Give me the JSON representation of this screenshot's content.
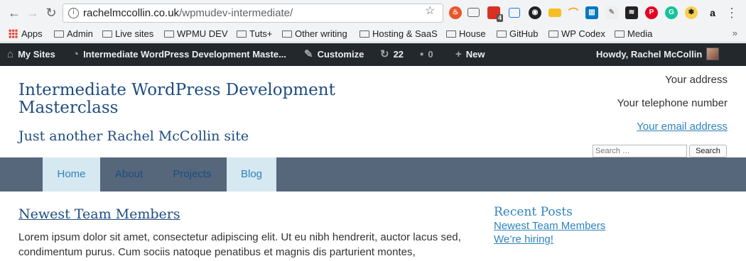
{
  "browser": {
    "url_host": "rachelmccollin.co.uk",
    "url_path": "/wpmudev-intermediate/",
    "extension_badge": "4",
    "bookmarks": [
      "Apps",
      "Admin",
      "Live sites",
      "WPMU DEV",
      "Tuts+",
      "Other writing",
      "Hosting & SaaS",
      "House",
      "GitHub",
      "WP Codex",
      "Media"
    ]
  },
  "adminbar": {
    "my_sites": "My Sites",
    "site_name": "Intermediate WordPress Development Maste...",
    "customize": "Customize",
    "updates_count": "22",
    "comments_count": "0",
    "new": "New",
    "howdy": "Howdy, Rachel McCollin"
  },
  "site": {
    "title": "Intermediate WordPress Development Masterclass",
    "tagline": "Just another Rachel McCollin site",
    "address": "Your address",
    "telephone": "Your telephone number",
    "email": "Your email address",
    "search_placeholder": "Search …",
    "search_button": "Search"
  },
  "menu": {
    "items": [
      "Home",
      "About",
      "Projects",
      "Blog"
    ]
  },
  "post": {
    "title": "Newest Team Members",
    "excerpt": "Lorem ipsum dolor sit amet, consectetur adipiscing elit. Ut eu nibh hendrerit, auctor lacus sed, condimentum purus. Cum sociis natoque penatibus et magnis dis parturient montes,"
  },
  "sidebar": {
    "recent_posts_title": "Recent Posts",
    "recent_posts": [
      "Newest Team Members",
      "We’re hiring!"
    ]
  },
  "colors": {
    "admin_bar": "#23282d",
    "menu_bar": "#56677c",
    "menu_highlight": "#d6e8f0",
    "title_blue": "#1e4d80",
    "link_blue": "#2e83bd"
  }
}
